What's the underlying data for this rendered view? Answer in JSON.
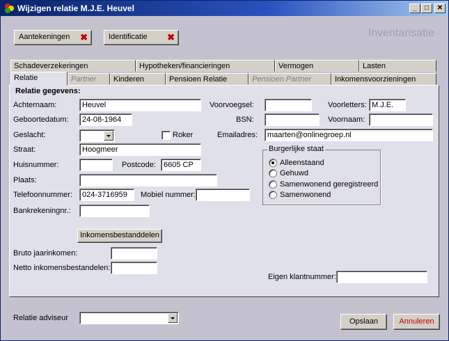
{
  "window": {
    "title": "Wijzigen relatie  M.J.E. Heuvel",
    "minimize": "_",
    "maximize": "□",
    "close": "✕"
  },
  "toolbar": {
    "notes_label": "Aantekeningen",
    "identification_label": "Identificatie",
    "delete_icon": "✖"
  },
  "heading": "Inventarisatie",
  "tabs_row1": [
    "Schadeverzekeringen",
    "Hypotheken/financieringen",
    "Vermogen",
    "Lasten"
  ],
  "tabs_row2": [
    "Relatie",
    "Partner",
    "Kinderen",
    "Pensioen Relatie",
    "Pensioen Partner",
    "Inkomensvoorzieningen"
  ],
  "form": {
    "section_title": "Relatie gegevens:",
    "achternaam_label": "Achternaam:",
    "achternaam": "Heuvel",
    "geboortedatum_label": "Geboortedatum:",
    "geboortedatum": "24-08-1964",
    "geslacht_label": "Geslacht:",
    "geslacht": "",
    "roker_label": "Roker",
    "straat_label": "Straat:",
    "straat": "Hoogmeer",
    "huisnummer_label": "Huisnummer:",
    "huisnummer": "",
    "postcode_label": "Postcode:",
    "postcode": "6605 CP",
    "plaats_label": "Plaats:",
    "plaats": "",
    "telefoon_label": "Telefoonnummer:",
    "telefoon": "024-3716959",
    "mobiel_label": "Mobiel nummer:",
    "mobiel": "",
    "bank_label": "Bankrekeningnr.:",
    "bank": "",
    "voorvoegsel_label": "Voorvoegsel:",
    "voorvoegsel": "",
    "voorletters_label": "Voorletters:",
    "voorletters": "M.J.E.",
    "bsn_label": "BSN:",
    "bsn": "",
    "voornaam_label": "Voornaam:",
    "voornaam": "",
    "email_label": "Emailadres:",
    "email": "maarten@onlinegroep.nl",
    "burgerlijke_label": "Burgerlijke staat",
    "burgerlijke_options": [
      "Alleenstaand",
      "Gehuwd",
      "Samenwonend geregistreerd",
      "Samenwonend"
    ],
    "inkomens_button": "Inkomensbestanddelen",
    "bruto_label": "Bruto jaarinkomen:",
    "bruto": "",
    "netto_label": "Netto inkomensbestandelen:",
    "netto": "",
    "klantnummer_label": "Eigen klantnummer:",
    "klantnummer": ""
  },
  "footer": {
    "adviseur_label": "Relatie adviseur",
    "adviseur": "",
    "save_label": "Opslaan",
    "cancel_label": "Annuleren"
  },
  "colors": {
    "title_bar": "#0a246a",
    "heading": "#9aa0b4",
    "delete_icon": "#c00000",
    "cancel_text": "#c00000"
  }
}
